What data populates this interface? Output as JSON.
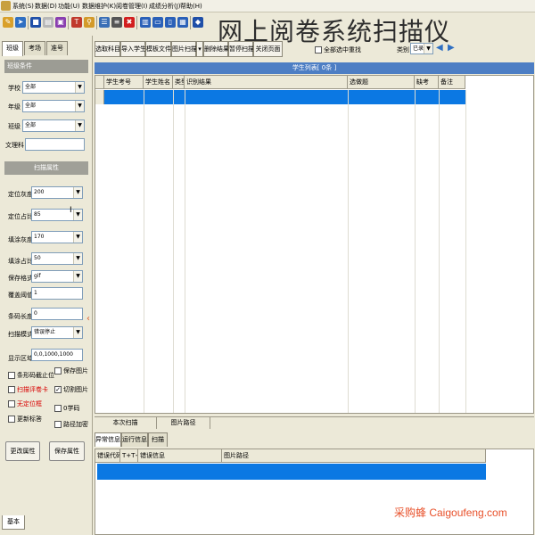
{
  "menu": [
    "系统(S)",
    "数据(D)",
    "功能(U)",
    "数据维护(K)",
    "阅卷管理(I)",
    "成绩分析(J)",
    "帮助(H)"
  ],
  "app_title": "网上阅卷系统扫描仪",
  "left_tabs": [
    "班级",
    "考场",
    "准号"
  ],
  "class_section": {
    "header": "班级条件",
    "fields": [
      {
        "label": "学校",
        "value": "全部"
      },
      {
        "label": "年级",
        "value": "全部"
      },
      {
        "label": "班级",
        "value": "全部"
      },
      {
        "label": "文理科",
        "value": ""
      }
    ]
  },
  "scan_section": {
    "header": "扫描属性",
    "fields": [
      {
        "label": "定位灰度",
        "value": "200"
      },
      {
        "label": "定位占比",
        "value": "85"
      },
      {
        "label": "填涂灰度",
        "value": "170"
      },
      {
        "label": "填涂占比",
        "value": "50"
      },
      {
        "label": "保存格式",
        "value": "gif"
      },
      {
        "label": "覆盖阈值",
        "value": "1"
      },
      {
        "label": "条码长度",
        "value": "0"
      },
      {
        "label": "扫描模式",
        "value": "错误停止"
      },
      {
        "label": "显示区域",
        "value": "0,0,1000,1000"
      }
    ],
    "checks_left": [
      {
        "label": "条形码截止位",
        "checked": false,
        "red": false
      },
      {
        "label": "扫描评卷卡",
        "checked": false,
        "red": true
      },
      {
        "label": "无定位框",
        "checked": false,
        "red": true
      },
      {
        "label": "更新标答",
        "checked": false,
        "red": false
      }
    ],
    "checks_right": [
      {
        "label": "保存图片",
        "checked": false
      },
      {
        "label": "切割图片",
        "checked": true
      },
      {
        "label": "0学码",
        "checked": false
      },
      {
        "label": "路径加密",
        "checked": false
      }
    ],
    "buttons": [
      "更改属性",
      "保存属性"
    ]
  },
  "top_tabs": [
    "选取科目",
    "导入学生",
    "模板文件",
    "图片扫描",
    "删除结果",
    "暂停扫描",
    "关闭页面"
  ],
  "top_right": {
    "all_select": "全部选中",
    "reset": "重找",
    "type_label": "类别",
    "type_value": "已录"
  },
  "list_title": "学生列表[ 0条 ]",
  "main_grid_columns": [
    "学生考号",
    "学生姓名",
    "类型",
    "识别结果",
    "选做题",
    "缺考",
    "备注"
  ],
  "footer_cells": [
    "本次扫描",
    "图片路径"
  ],
  "bottom_tabs": [
    "异常信息",
    "运行信息",
    "扫描仪"
  ],
  "bottom_grid_columns": [
    "错误代码",
    "T+T+I",
    "错误信息",
    "图片路径"
  ],
  "bottom_left_tab": "基本",
  "watermark": "采购蜂 Caigoufeng.com"
}
